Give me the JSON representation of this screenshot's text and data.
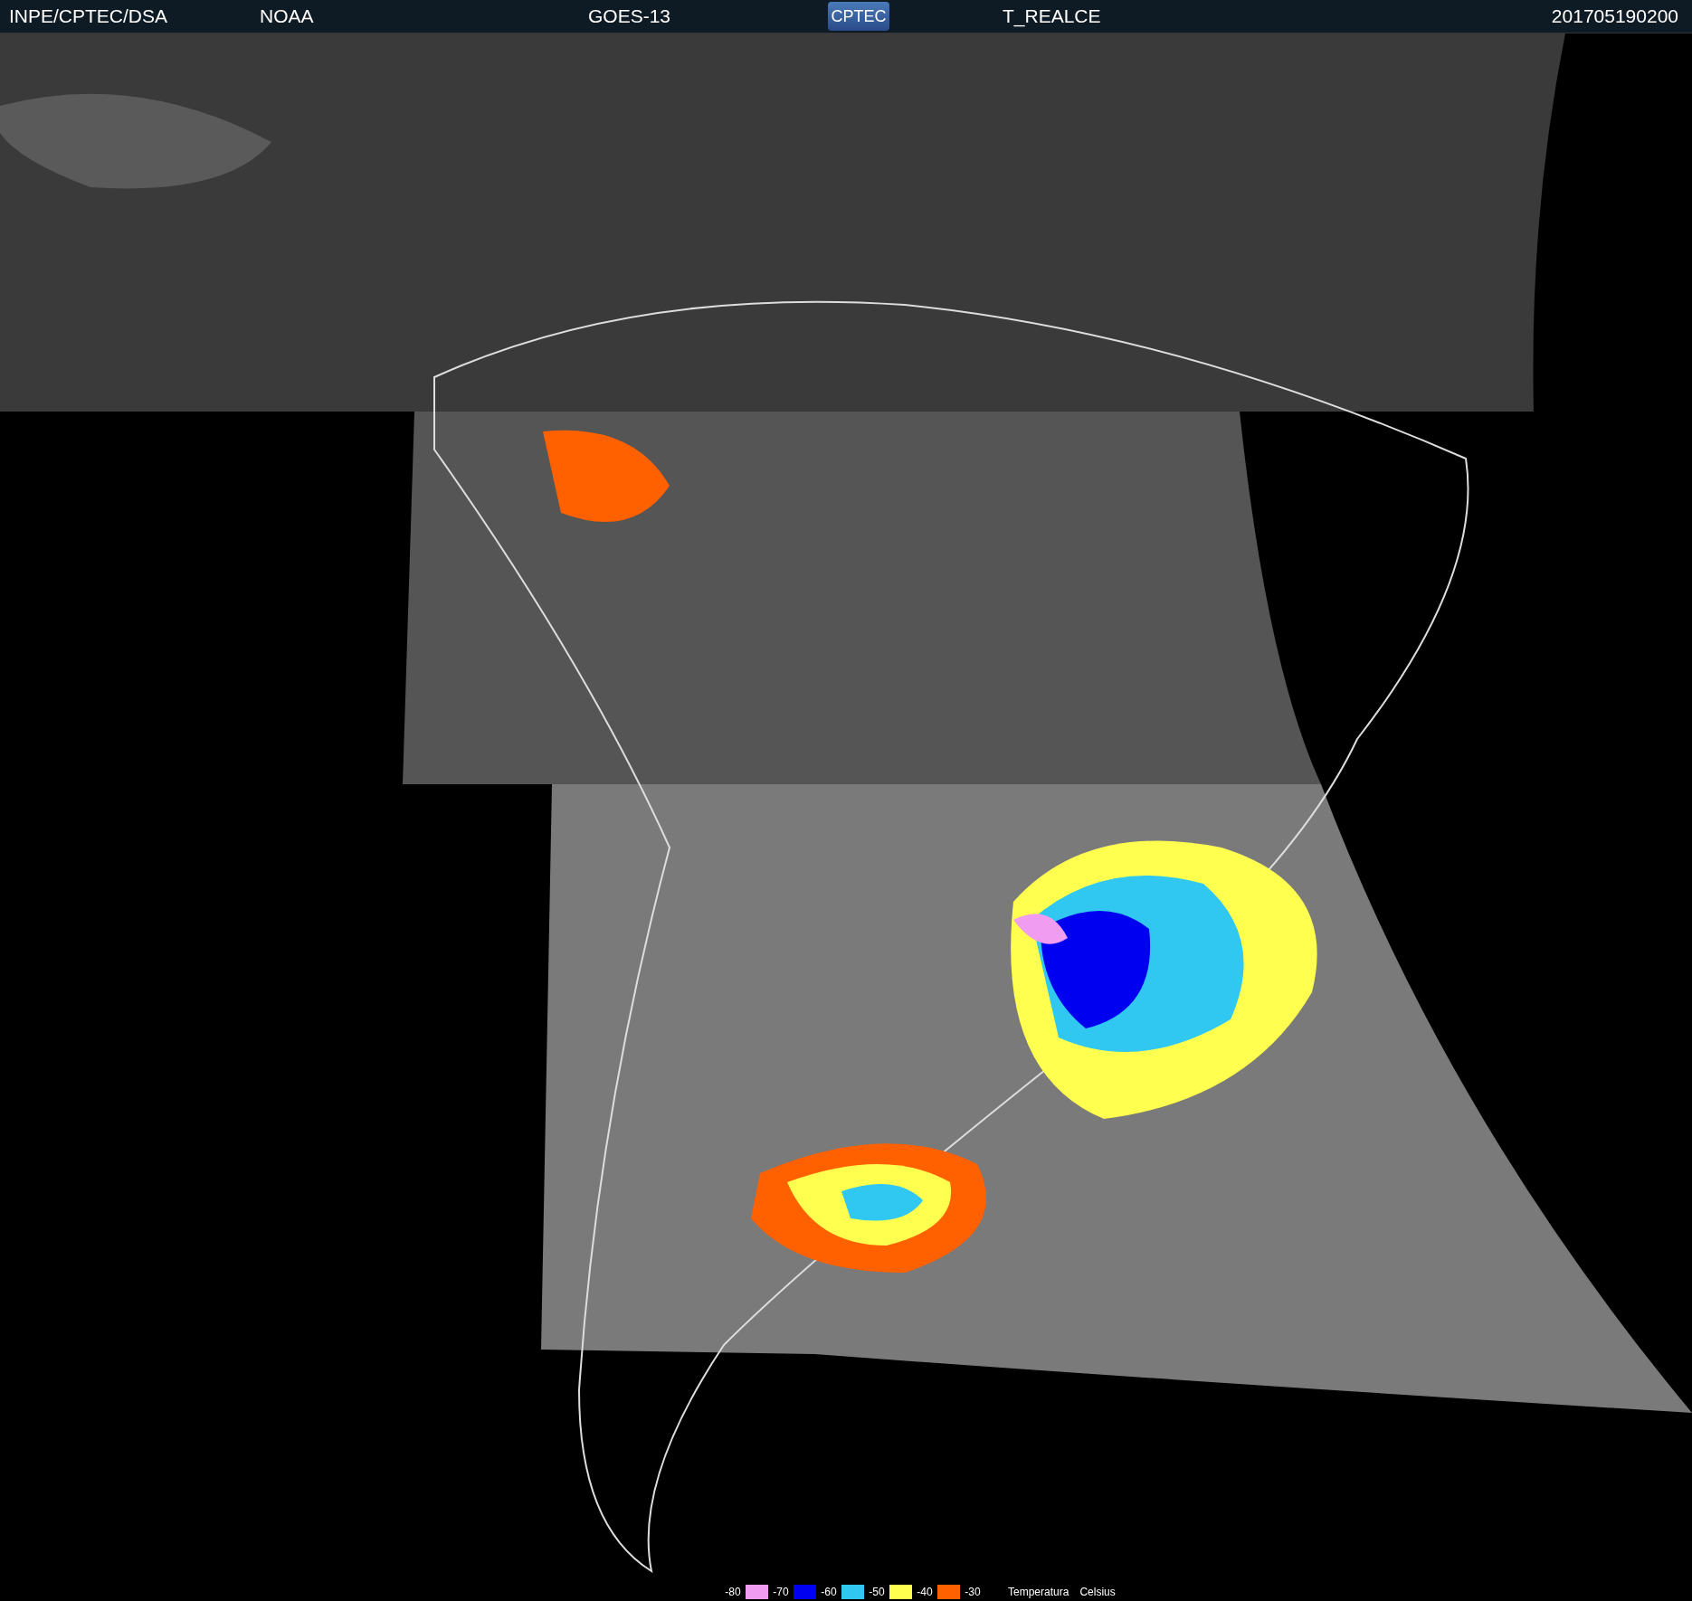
{
  "header": {
    "agency": "INPE/CPTEC/DSA",
    "source": "NOAA",
    "satellite": "GOES-13",
    "logo": "CPTEC",
    "product": "T_REALCE",
    "timestamp": "201705190200"
  },
  "legend": {
    "items": [
      {
        "label": "-80",
        "color": "#f09cf0"
      },
      {
        "label": "-70",
        "color": "#0000f0"
      },
      {
        "label": "-60",
        "color": "#30c8f0"
      },
      {
        "label": "-50",
        "color": "#ffff50"
      },
      {
        "label": "-40",
        "color": "#ff6000"
      }
    ],
    "end_label": "-30",
    "title": "Temperatura",
    "unit": "Celsius"
  }
}
